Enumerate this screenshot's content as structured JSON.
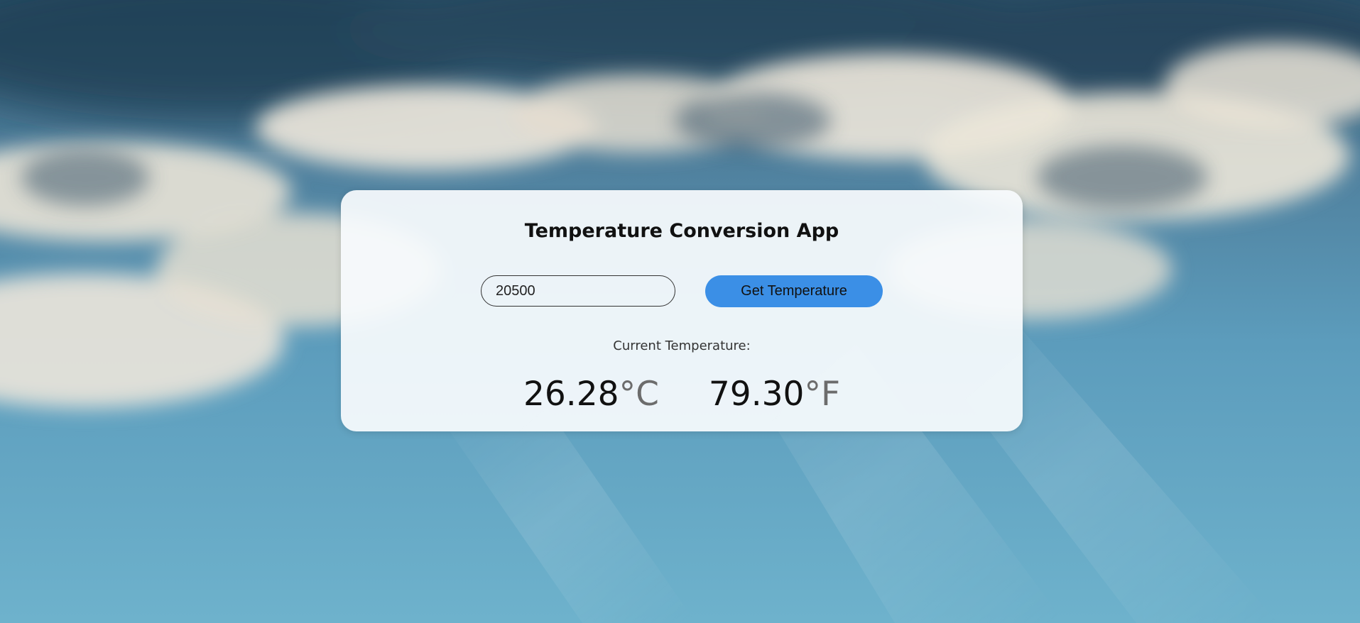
{
  "app": {
    "title": "Temperature Conversion App"
  },
  "form": {
    "zip_value": "20500",
    "button_label": "Get Temperature"
  },
  "result": {
    "label": "Current Temperature:",
    "celsius_value": "26.28",
    "celsius_unit": "°C",
    "fahrenheit_value": "79.30",
    "fahrenheit_unit": "°F"
  },
  "colors": {
    "button": "#3b8fe6",
    "unit_text": "#6c6c6c"
  }
}
